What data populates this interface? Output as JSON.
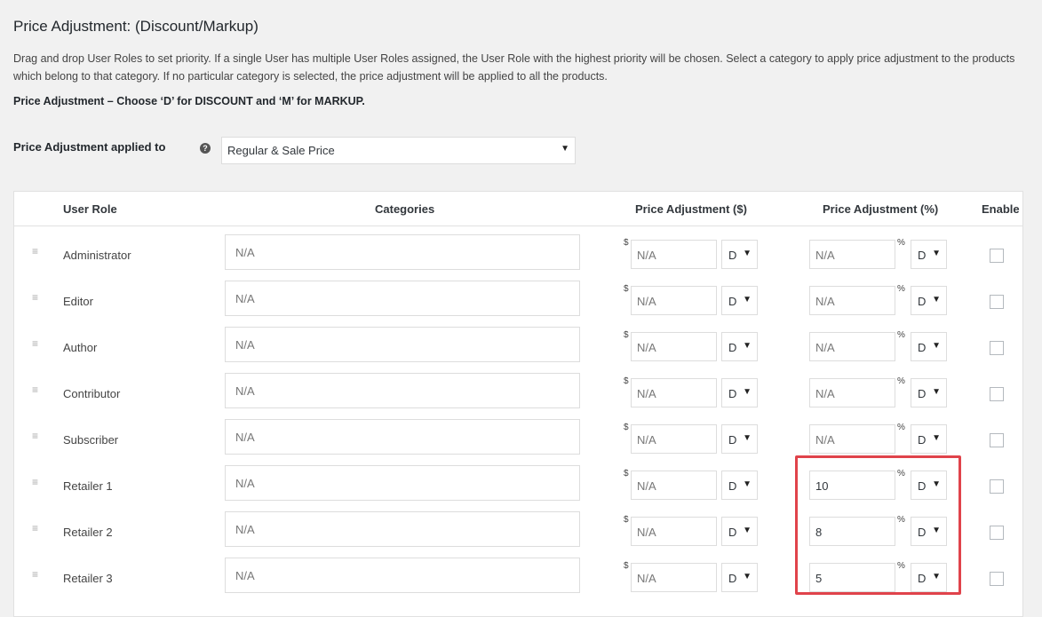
{
  "title": "Price Adjustment: (Discount/Markup)",
  "description": "Drag and drop User Roles to set priority. If a single User has multiple User Roles assigned, the User Role with the highest priority will be chosen. Select a category to apply price adjustment to the products which belong to that category. If no particular category is selected, the price adjustment will be applied to all the products.",
  "note": "Price Adjustment – Choose ‘D’ for DISCOUNT and ‘M’ for MARKUP.",
  "applied_to": {
    "label": "Price Adjustment applied to",
    "help_icon": "?",
    "selected": "Regular & Sale Price",
    "arrow": "▼"
  },
  "table": {
    "headers": {
      "role": "User Role",
      "categories": "Categories",
      "adj_dollar": "Price Adjustment ($)",
      "adj_percent": "Price Adjustment (%)",
      "enable": "Enable"
    },
    "currency_symbol": "$",
    "percent_symbol": "%",
    "drag_glyph": "≡",
    "dropdown_arrow": "▼",
    "rows": [
      {
        "role": "Administrator",
        "category": "N/A",
        "dollar": "N/A",
        "dollar_type": "D",
        "percent": "N/A",
        "percent_type": "D",
        "enabled": false
      },
      {
        "role": "Editor",
        "category": "N/A",
        "dollar": "N/A",
        "dollar_type": "D",
        "percent": "N/A",
        "percent_type": "D",
        "enabled": false
      },
      {
        "role": "Author",
        "category": "N/A",
        "dollar": "N/A",
        "dollar_type": "D",
        "percent": "N/A",
        "percent_type": "D",
        "enabled": false
      },
      {
        "role": "Contributor",
        "category": "N/A",
        "dollar": "N/A",
        "dollar_type": "D",
        "percent": "N/A",
        "percent_type": "D",
        "enabled": false
      },
      {
        "role": "Subscriber",
        "category": "N/A",
        "dollar": "N/A",
        "dollar_type": "D",
        "percent": "N/A",
        "percent_type": "D",
        "enabled": false
      },
      {
        "role": "Retailer 1",
        "category": "N/A",
        "dollar": "N/A",
        "dollar_type": "D",
        "percent": "10",
        "percent_type": "D",
        "enabled": false
      },
      {
        "role": "Retailer 2",
        "category": "N/A",
        "dollar": "N/A",
        "dollar_type": "D",
        "percent": "8",
        "percent_type": "D",
        "enabled": false
      },
      {
        "role": "Retailer 3",
        "category": "N/A",
        "dollar": "N/A",
        "dollar_type": "D",
        "percent": "5",
        "percent_type": "D",
        "enabled": false
      }
    ]
  },
  "colors": {
    "highlight": "#e0434b",
    "background": "#f1f1f1"
  }
}
